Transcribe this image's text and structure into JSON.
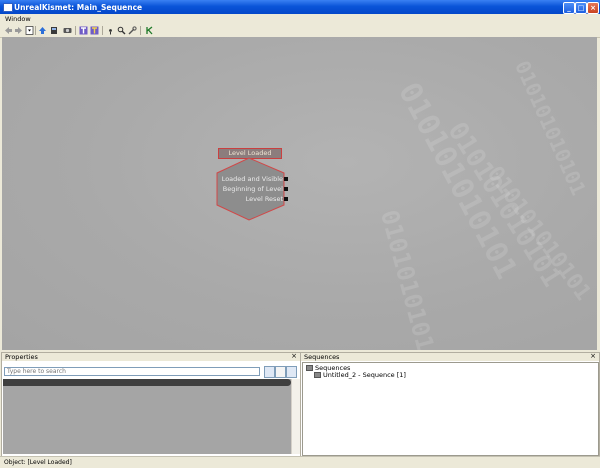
{
  "window": {
    "title": "UnrealKismet: Main_Sequence"
  },
  "menu": {
    "items": [
      "Window"
    ]
  },
  "node": {
    "title": "Level Loaded",
    "outputs": [
      "Loaded and Visible",
      "Beginning of Level",
      "Level Reset"
    ]
  },
  "properties": {
    "title": "Properties",
    "search_placeholder": "Type here to search"
  },
  "sequences": {
    "title": "Sequences",
    "root": "Sequences",
    "items": [
      "Untitled_2 - Sequence [1]"
    ]
  },
  "status": {
    "text": "Object: [Level Loaded]"
  },
  "watermark": {
    "text": "010101010101"
  }
}
